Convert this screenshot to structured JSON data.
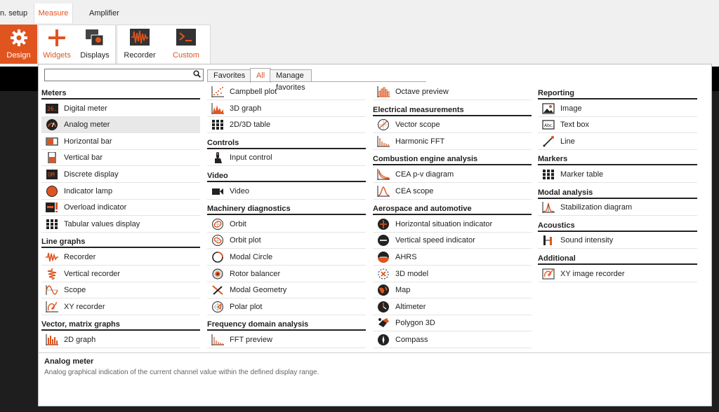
{
  "tabs": [
    {
      "label": "n. setup"
    },
    {
      "label": "Measure"
    },
    {
      "label": "Amplifier"
    }
  ],
  "ribbon": {
    "design": "Design",
    "widgets": "Widgets",
    "displays": "Displays",
    "recorder": "Recorder",
    "custom": "Custom"
  },
  "search": {
    "value": "",
    "placeholder": ""
  },
  "filter_tabs": [
    {
      "label": "Favorites"
    },
    {
      "label": "All"
    },
    {
      "label": "Manage favorites"
    }
  ],
  "columns": [
    {
      "sections": [
        {
          "title": "Meters",
          "items": [
            {
              "label": "Digital meter",
              "icon": "digital-meter-icon"
            },
            {
              "label": "Analog meter",
              "icon": "analog-meter-icon",
              "selected": true
            },
            {
              "label": "Horizontal bar",
              "icon": "horizontal-bar-icon"
            },
            {
              "label": "Vertical bar",
              "icon": "vertical-bar-icon"
            },
            {
              "label": "Discrete display",
              "icon": "discrete-display-icon"
            },
            {
              "label": "Indicator lamp",
              "icon": "indicator-lamp-icon"
            },
            {
              "label": "Overload indicator",
              "icon": "overload-indicator-icon"
            },
            {
              "label": "Tabular values display",
              "icon": "tabular-values-icon"
            }
          ]
        },
        {
          "title": "Line graphs",
          "items": [
            {
              "label": "Recorder",
              "icon": "recorder-icon"
            },
            {
              "label": "Vertical recorder",
              "icon": "vertical-recorder-icon"
            },
            {
              "label": "Scope",
              "icon": "scope-icon"
            },
            {
              "label": "XY recorder",
              "icon": "xy-recorder-icon"
            }
          ]
        },
        {
          "title": "Vector, matrix graphs",
          "items": [
            {
              "label": "2D graph",
              "icon": "2d-graph-icon"
            }
          ]
        }
      ]
    },
    {
      "sections": [
        {
          "title": "",
          "items": [
            {
              "label": "Campbell plot",
              "icon": "campbell-plot-icon"
            },
            {
              "label": "3D graph",
              "icon": "3d-graph-icon"
            },
            {
              "label": "2D/3D table",
              "icon": "table-icon"
            }
          ]
        },
        {
          "title": "Controls",
          "items": [
            {
              "label": "Input control",
              "icon": "input-control-icon"
            }
          ]
        },
        {
          "title": "Video",
          "items": [
            {
              "label": "Video",
              "icon": "video-icon"
            }
          ]
        },
        {
          "title": "Machinery diagnostics",
          "items": [
            {
              "label": "Orbit",
              "icon": "orbit-icon"
            },
            {
              "label": "Orbit plot",
              "icon": "orbit-plot-icon"
            },
            {
              "label": "Modal Circle",
              "icon": "modal-circle-icon"
            },
            {
              "label": "Rotor balancer",
              "icon": "rotor-balancer-icon"
            },
            {
              "label": "Modal Geometry",
              "icon": "modal-geometry-icon"
            },
            {
              "label": "Polar plot",
              "icon": "polar-plot-icon"
            }
          ]
        },
        {
          "title": "Frequency domain analysis",
          "items": [
            {
              "label": "FFT preview",
              "icon": "fft-preview-icon"
            }
          ]
        }
      ]
    },
    {
      "sections": [
        {
          "title": "",
          "items": [
            {
              "label": "Octave preview",
              "icon": "octave-preview-icon"
            }
          ]
        },
        {
          "title": "Electrical measurements",
          "items": [
            {
              "label": "Vector scope",
              "icon": "vector-scope-icon"
            },
            {
              "label": "Harmonic FFT",
              "icon": "harmonic-fft-icon"
            }
          ]
        },
        {
          "title": "Combustion engine analysis",
          "items": [
            {
              "label": "CEA p-v diagram",
              "icon": "pv-diagram-icon"
            },
            {
              "label": "CEA scope",
              "icon": "cea-scope-icon"
            }
          ]
        },
        {
          "title": "Aerospace and automotive",
          "items": [
            {
              "label": "Horizontal situation indicator",
              "icon": "hsi-icon"
            },
            {
              "label": "Vertical speed indicator",
              "icon": "vsi-icon"
            },
            {
              "label": "AHRS",
              "icon": "ahrs-icon"
            },
            {
              "label": "3D model",
              "icon": "3d-model-icon"
            },
            {
              "label": "Map",
              "icon": "map-icon"
            },
            {
              "label": "Altimeter",
              "icon": "altimeter-icon"
            },
            {
              "label": "Polygon 3D",
              "icon": "polygon-3d-icon"
            },
            {
              "label": "Compass",
              "icon": "compass-icon"
            }
          ]
        }
      ]
    },
    {
      "sections": [
        {
          "title": "Reporting",
          "items": [
            {
              "label": "Image",
              "icon": "image-icon"
            },
            {
              "label": "Text box",
              "icon": "text-box-icon"
            },
            {
              "label": "Line",
              "icon": "line-icon"
            }
          ]
        },
        {
          "title": "Markers",
          "items": [
            {
              "label": "Marker table",
              "icon": "marker-table-icon"
            }
          ]
        },
        {
          "title": "Modal analysis",
          "items": [
            {
              "label": "Stabilization diagram",
              "icon": "stabilization-diagram-icon"
            }
          ]
        },
        {
          "title": "Acoustics",
          "items": [
            {
              "label": "Sound intensity",
              "icon": "sound-intensity-icon"
            }
          ]
        },
        {
          "title": "Additional",
          "items": [
            {
              "label": "XY image recorder",
              "icon": "xy-image-recorder-icon"
            }
          ]
        }
      ]
    }
  ],
  "description": {
    "title": "Analog meter",
    "text": "Analog graphical indication of the current channel value within the defined display range."
  },
  "colors": {
    "accent": "#e0541f",
    "design_bg": "#e0541f"
  }
}
